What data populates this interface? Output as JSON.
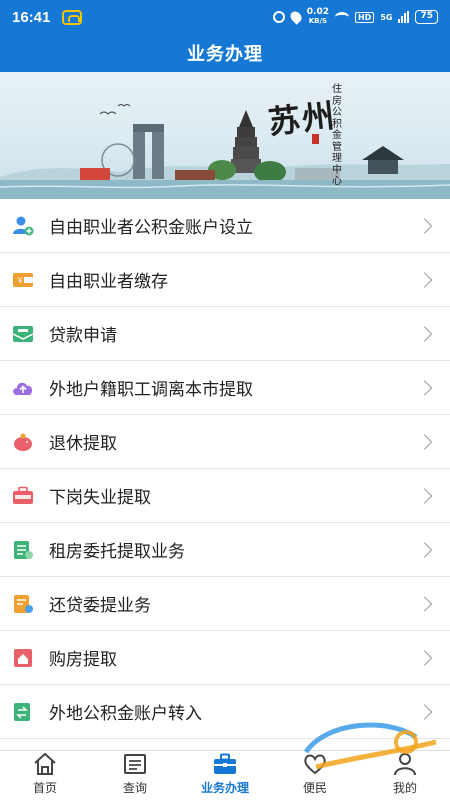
{
  "status_bar": {
    "time": "16:41",
    "net_speed": "0.02",
    "net_unit": "KB/S",
    "hd": "HD",
    "signal": "5G",
    "battery": "75"
  },
  "header": {
    "title": "业务办理"
  },
  "banner": {
    "logo": "苏州",
    "subtitle": "住房公积金管理中心"
  },
  "menu": [
    {
      "label": "自由职业者公积金账户设立",
      "icon": "user-add-icon",
      "color": "#3a8ee6"
    },
    {
      "label": "自由职业者缴存",
      "icon": "wallet-icon",
      "color": "#f0a030"
    },
    {
      "label": "贷款申请",
      "icon": "loan-envelope-icon",
      "color": "#3db37a"
    },
    {
      "label": "外地户籍职工调离本市提取",
      "icon": "cloud-upload-icon",
      "color": "#9a6ee0"
    },
    {
      "label": "退休提取",
      "icon": "piggy-bank-icon",
      "color": "#e8606a"
    },
    {
      "label": "下岗失业提取",
      "icon": "briefcase-icon",
      "color": "#e8606a"
    },
    {
      "label": "租房委托提取业务",
      "icon": "rental-doc-icon",
      "color": "#3db37a"
    },
    {
      "label": "还贷委提业务",
      "icon": "repay-doc-icon",
      "color": "#f0a030"
    },
    {
      "label": "购房提取",
      "icon": "house-doc-icon",
      "color": "#e8606a"
    },
    {
      "label": "外地公积金账户转入",
      "icon": "transfer-doc-icon",
      "color": "#3db37a"
    }
  ],
  "tabs": [
    {
      "label": "首页",
      "icon": "home-icon"
    },
    {
      "label": "查询",
      "icon": "query-icon"
    },
    {
      "label": "业务办理",
      "icon": "briefcase-tab-icon",
      "active": true
    },
    {
      "label": "便民",
      "icon": "heart-icon"
    },
    {
      "label": "我的",
      "icon": "user-icon"
    }
  ],
  "colors": {
    "primary": "#1478d4",
    "active_tab": "#1478d4"
  }
}
